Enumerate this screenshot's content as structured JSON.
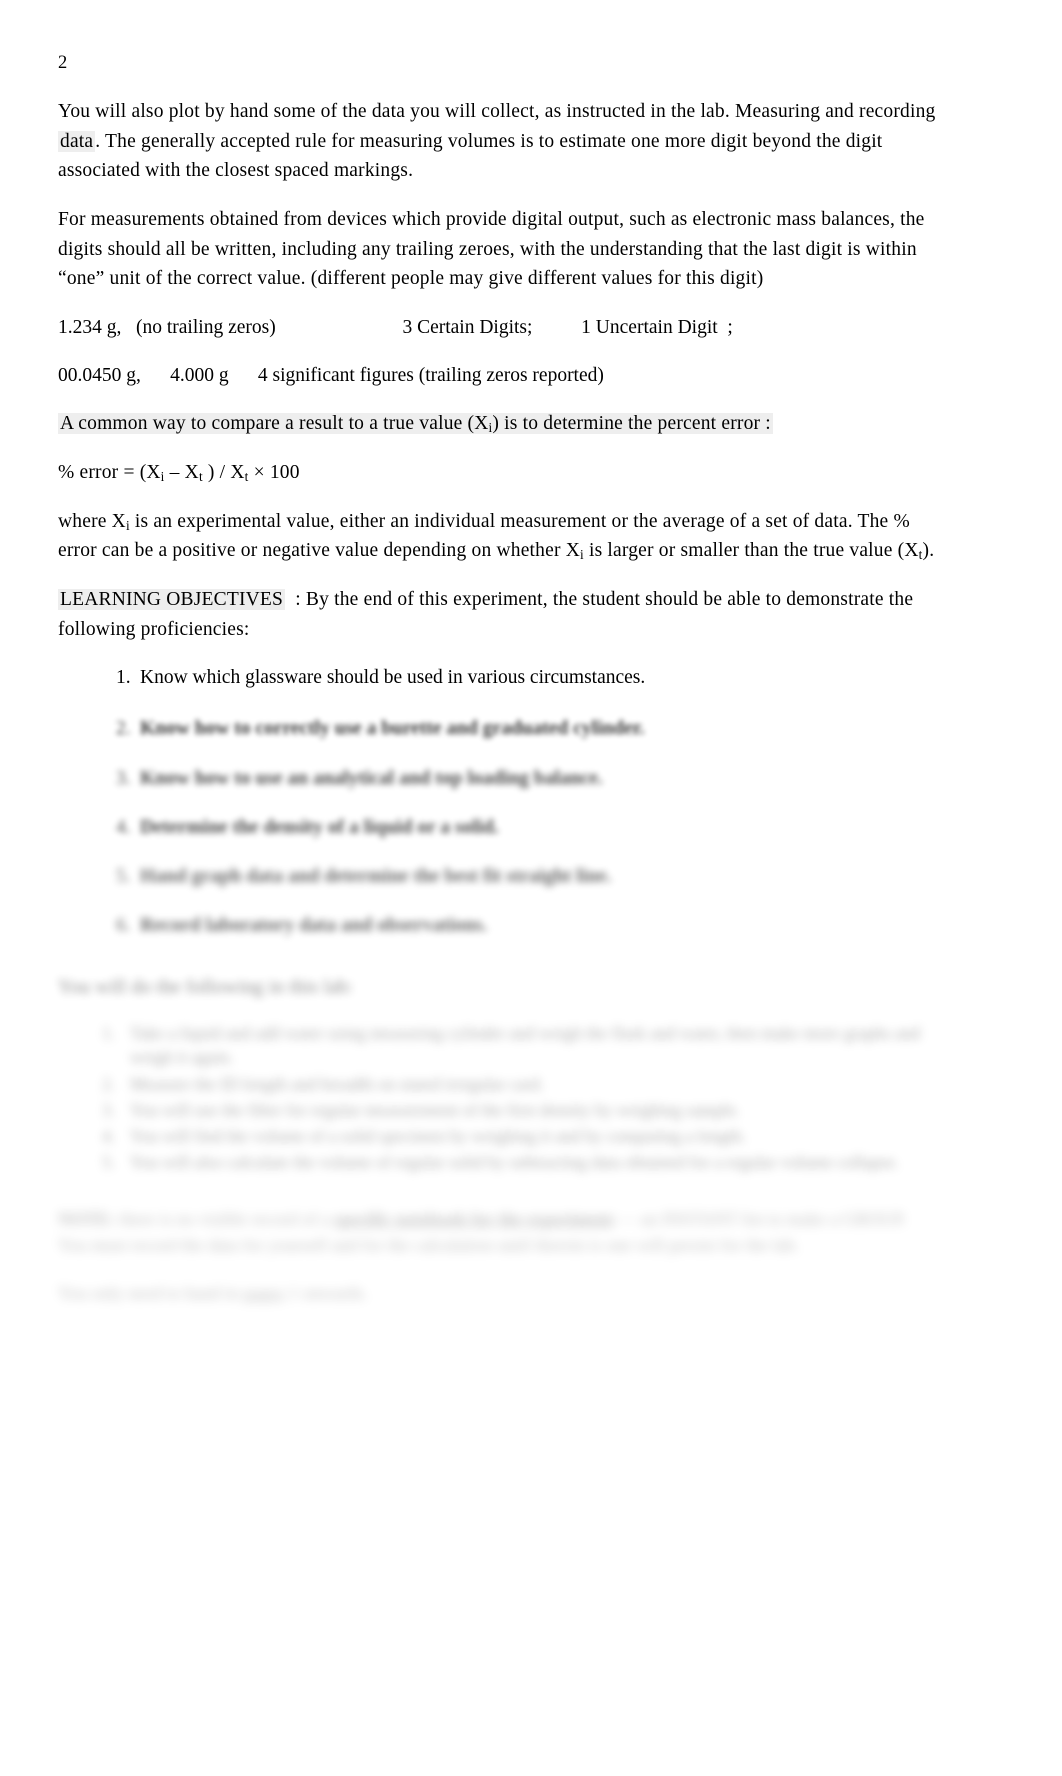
{
  "document": {
    "page_number": "2",
    "paragraphs": {
      "p1_part1": "You will also plot by hand some of the data you will collect, as instructed in the lab. Measuring and recording",
      "p1_part2": "data",
      "p1_part3": ".  The generally accepted rule for measuring volumes is to estimate one more digit beyond the digit associated with the closest spaced markings.",
      "p2": "For measurements obtained from devices which provide digital output, such as electronic mass balances, the digits should all be written, including any trailing zeroes, with the understanding that the last digit is within “one” unit of the correct value. (different people may give different values for this digit)",
      "example_line_1": "1.234 g,   (no trailing zeros)                          3 Certain Digits;          1 Uncertain Digit  ;",
      "example_line_2": "00.0450 g,      4.000 g      4 significant figures (trailing zeros reported)",
      "percent_error_intro_a": "A common way to compare a result to a true value (X",
      "percent_error_intro_sub": "i",
      "percent_error_intro_b": ") is to determine the percent error :",
      "formula_a": "% error = (X",
      "formula_sub1": "i",
      "formula_b": " – X",
      "formula_sub2": "t",
      "formula_c": " ) / X",
      "formula_sub3": "t",
      "formula_d": " × 100",
      "where_a": "where  X",
      "where_sub1": "i",
      "where_b": " is an experimental value, either an individual measurement or the average of a set of data.  The % error can be a positive or negative value depending on whether X",
      "where_sub2": "i",
      "where_c": "  is larger or smaller than the true value (X",
      "where_sub3": "t",
      "where_d": ")."
    },
    "learning_objectives": {
      "heading": "LEARNING OBJECTIVES",
      "heading_rest": ":  By the end of this experiment, the student should be able to demonstrate the following proficiencies:",
      "items": [
        {
          "num": "1.",
          "text": "Know which glassware should be used in various circumstances."
        },
        {
          "num": "2.",
          "text": "Know how to correctly use a burette and graduated cylinder."
        },
        {
          "num": "3.",
          "text": "Know how to use an analytical and top loading balance."
        },
        {
          "num": "4.",
          "text": "Determine the density of a liquid or a solid."
        },
        {
          "num": "5.",
          "text": "Hand graph data and determine the best fit straight line."
        },
        {
          "num": "6.",
          "text": "Record laboratory data and observations."
        }
      ]
    },
    "procedure": {
      "intro": "You will do the following in this lab:",
      "steps": [
        {
          "num": "1.",
          "text": "Take a liquid and add water using measuring cylinder and weigh the flask and water, then make more graphs and weigh it again."
        },
        {
          "num": "2.",
          "text": "Measure the ID length and breadth on stated irregular card."
        },
        {
          "num": "3.",
          "text": "You will use the filter for regular measurement of the first density by weighing sample."
        },
        {
          "num": "4.",
          "text": "You will find the volume of a solid specimen by weighing it and by computing a length."
        },
        {
          "num": "5.",
          "text": "You will also calculate the volume of regular solid by subtracting data obtained for a regular volume collapse."
        }
      ]
    },
    "notes": {
      "note_1_a": "NOTE:",
      "note_1_b": "there is no visible record of a",
      "note_1_c": "specific notebook for the experiment",
      "note_1_d": "— an INSTANT list to make a",
      "note_1_e": "GROUP.  You must record the data for yourself and for the calculation until therein is one will persist for the lab.",
      "note_2_a": "You only need to hand in",
      "note_2_b": "pages",
      "note_2_c": "1 onwards."
    }
  }
}
